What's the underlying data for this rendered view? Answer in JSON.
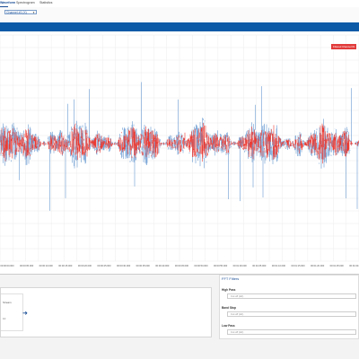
{
  "tabs": [
    {
      "label": "Waveform",
      "active": true
    },
    {
      "label": "Spectrogram",
      "active": false
    },
    {
      "label": "Statistics",
      "active": false
    }
  ],
  "toolbar": {
    "channel_select": "Channel #1 (X)"
  },
  "legend": {
    "label": "Filtered Channel #1"
  },
  "chart_data": {
    "type": "line",
    "title": "",
    "xlabel": "",
    "ylabel": "",
    "x_ticks": [
      "00:00:00.000",
      "00:00:05.000",
      "00:00:10.000",
      "00:00:15.000",
      "00:00:20.000",
      "00:00:25.000",
      "00:00:30.000",
      "00:00:35.000",
      "00:00:40.000",
      "00:00:45.000",
      "00:00:50.000",
      "00:00:55.000",
      "00:01:00.000",
      "00:01:05.000",
      "00:01:10.000",
      "00:01:15.000",
      "00:01:20.000",
      "00:01:25.000",
      "00:01:30.000"
    ],
    "grid": true,
    "series": [
      {
        "name": "",
        "color": "#4a86c8"
      },
      {
        "name": "Filtered Channel #1",
        "color": "#ec3b33"
      }
    ]
  },
  "bottom_left": {
    "label": "Stream",
    "value": "10",
    "hint": "10"
  },
  "fft": {
    "title": "FFT Filters",
    "high_pass": {
      "label": "High Pass",
      "placeholder": "Cut off (Hz)"
    },
    "band_stop": {
      "label": "Band Stop",
      "placeholder": "Cut off (Hz)"
    },
    "low_pass": {
      "label": "Low Pass",
      "placeholder": "Cut off (Hz)"
    }
  },
  "colors": {
    "accent": "#0a5aa8",
    "raw": "#4a86c8",
    "filtered": "#ec3b33"
  }
}
